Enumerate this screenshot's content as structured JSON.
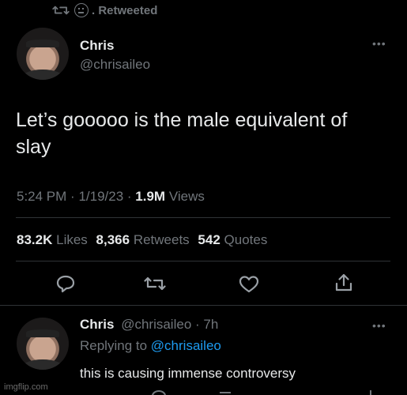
{
  "retweet_header": {
    "label": "Retweeted"
  },
  "tweet": {
    "author_name": "Chris",
    "author_handle": "@chrisaileo",
    "text_line1": "Let’s gooooo is the male equivalent of",
    "text_line2": "slay",
    "time": "5:24 PM",
    "date": "1/19/23",
    "views_count": "1.9M",
    "views_label": "Views",
    "likes_count": "83.2K",
    "likes_label": "Likes",
    "retweets_count": "8,366",
    "retweets_label": "Retweets",
    "quotes_count": "542",
    "quotes_label": "Quotes"
  },
  "reply": {
    "author_name": "Chris",
    "author_handle": "@chrisaileo",
    "age": "7h",
    "replying_prefix": "Replying to",
    "replying_handle": "@chrisaileo",
    "text": "this is causing immense controversy"
  },
  "watermark": "imgflip.com",
  "colors": {
    "background": "#000000",
    "text": "#e7e9ea",
    "muted": "#71767b",
    "accent": "#1d9bf0",
    "divider": "#2f3336"
  }
}
